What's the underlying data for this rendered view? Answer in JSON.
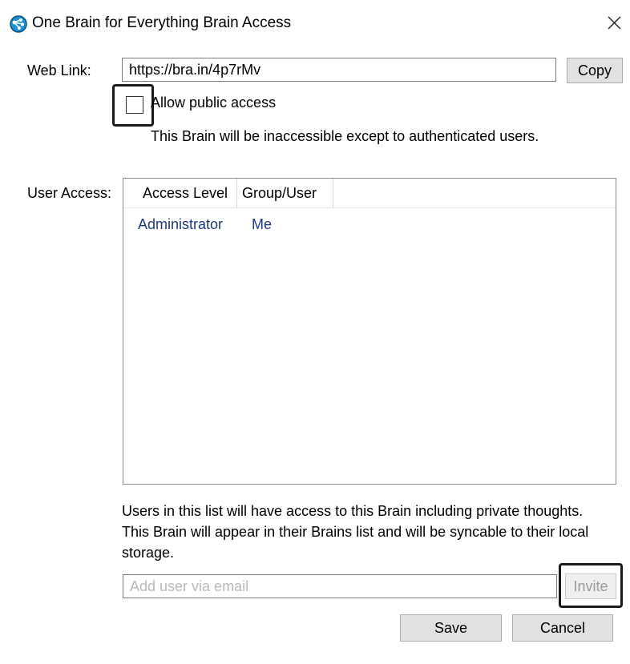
{
  "window": {
    "title": "One Brain for Everything Brain Access",
    "app_icon": "thebrain-app-icon",
    "close_icon": "close-x-icon"
  },
  "web_link": {
    "label": "Web Link:",
    "value": "https://bra.in/4p7rMv",
    "copy_label": "Copy"
  },
  "public_access": {
    "checked": false,
    "label": "Allow public access",
    "description": "This Brain will be inaccessible except to authenticated users."
  },
  "user_access": {
    "label": "User Access:",
    "columns": [
      "Access Level",
      "Group/User"
    ],
    "rows": [
      {
        "access_level": "Administrator",
        "group_user": "Me"
      }
    ],
    "note": "Users in this list will have access to this Brain including private thoughts. This Brain will appear in their Brains list and will be syncable to their local storage."
  },
  "invite": {
    "placeholder": "Add user via email",
    "value": "",
    "button_label": "Invite"
  },
  "actions": {
    "save_label": "Save",
    "cancel_label": "Cancel"
  },
  "colors": {
    "list_text": "#1f3a7a",
    "icon_blue": "#1d8fd3",
    "button_bg": "#e1e1e1",
    "highlight_border": "#1a1a1a"
  }
}
